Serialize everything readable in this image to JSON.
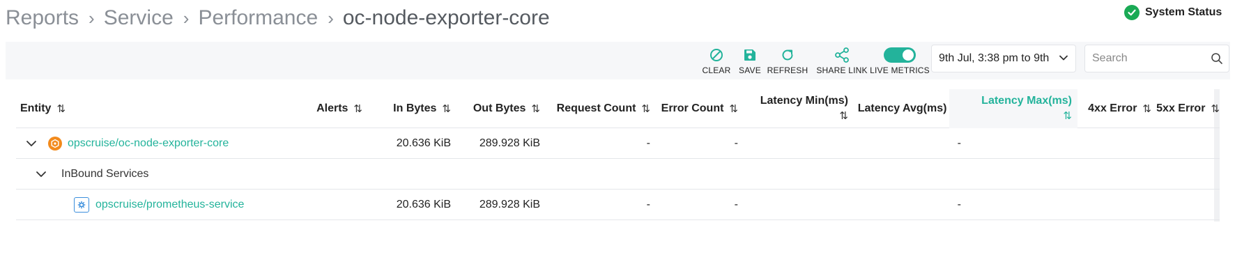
{
  "breadcrumb": {
    "items": [
      "Reports",
      "Service",
      "Performance",
      "oc-node-exporter-core"
    ],
    "separator": "›"
  },
  "system_status": {
    "label": "System Status",
    "color": "#1aaa55"
  },
  "toolbar": {
    "clear_label": "CLEAR",
    "save_label": "SAVE",
    "refresh_label": "REFRESH",
    "share_label": "SHARE LINK",
    "live_label": "LIVE METRICS",
    "live_on": true,
    "date_range": "9th Jul, 3:38 pm to 9th",
    "search_placeholder": "Search"
  },
  "table": {
    "columns": {
      "entity": "Entity",
      "alerts": "Alerts",
      "in_bytes": "In Bytes",
      "out_bytes": "Out Bytes",
      "request_count": "Request Count",
      "error_count": "Error Count",
      "latency_min": "Latency Min(ms)",
      "latency_avg": "Latency Avg(ms)",
      "latency_max": "Latency Max(ms)",
      "err_4xx": "4xx Error",
      "err_5xx": "5xx Error",
      "sort_glyph": "⇅"
    },
    "rows": [
      {
        "name": "opscruise/oc-node-exporter-core",
        "in_bytes": "20.636 KiB",
        "out_bytes": "289.928 KiB",
        "request_count": "-",
        "error_count": "-",
        "latency_avg": "-"
      },
      {
        "group": "InBound Services"
      },
      {
        "name": "opscruise/prometheus-service",
        "in_bytes": "20.636 KiB",
        "out_bytes": "289.928 KiB",
        "request_count": "-",
        "error_count": "-",
        "latency_avg": "-"
      }
    ]
  },
  "colors": {
    "accent": "#23b39b",
    "muted_text": "#8a8f96",
    "entity_icon": "#f28a1c",
    "service_icon": "#3a8edc"
  },
  "icons": [
    "check-circle-icon",
    "clear-icon",
    "save-icon",
    "refresh-icon",
    "share-icon",
    "toggle",
    "chevron-down-icon",
    "search-icon",
    "kubernetes-icon",
    "service-icon"
  ]
}
